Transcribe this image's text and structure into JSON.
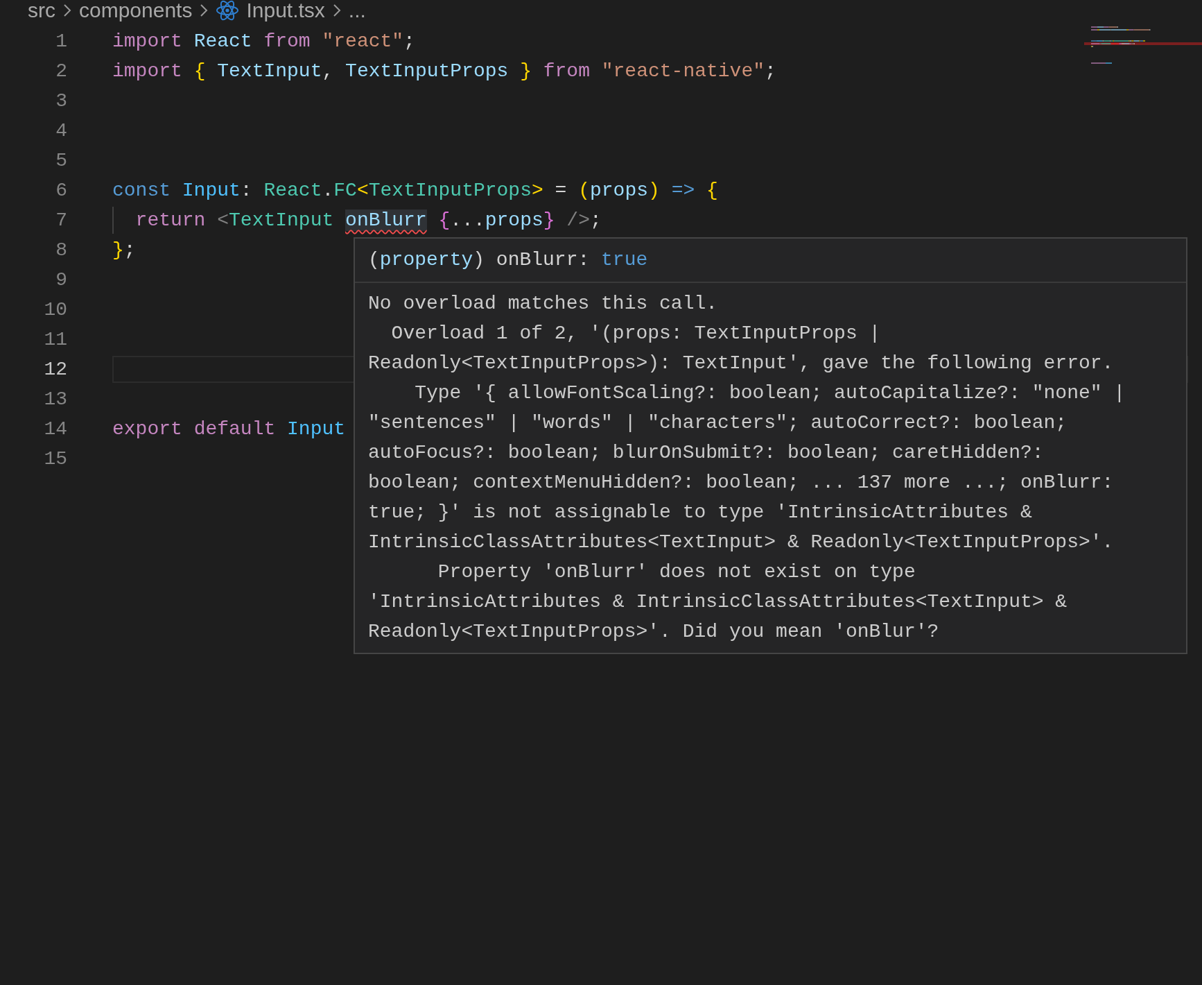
{
  "breadcrumb": [
    {
      "label": "src",
      "kind": "folder"
    },
    {
      "label": "components",
      "kind": "folder"
    },
    {
      "label": "Input.tsx",
      "kind": "react-file"
    },
    {
      "label": "...",
      "kind": "more"
    }
  ],
  "editor": {
    "lines": [
      {
        "number": "1",
        "current": false,
        "tokens": [
          {
            "text": "import",
            "kind": "keyword"
          },
          {
            "text": " React",
            "kind": "variable"
          },
          {
            "text": " from",
            "kind": "keyword"
          },
          {
            "text": " \"react\"",
            "kind": "string"
          },
          {
            "text": ";",
            "kind": "plain"
          }
        ]
      },
      {
        "number": "2",
        "current": false,
        "tokens": [
          {
            "text": "import",
            "kind": "keyword"
          },
          {
            "text": " {",
            "kind": "bracket1"
          },
          {
            "text": " TextInput",
            "kind": "variable"
          },
          {
            "text": ",",
            "kind": "plain"
          },
          {
            "text": " TextInputProps",
            "kind": "variable"
          },
          {
            "text": " }",
            "kind": "bracket1"
          },
          {
            "text": " from",
            "kind": "keyword"
          },
          {
            "text": " \"react-native\"",
            "kind": "string"
          },
          {
            "text": ";",
            "kind": "plain"
          }
        ]
      },
      {
        "number": "3",
        "current": false
      },
      {
        "number": "4",
        "current": false
      },
      {
        "number": "5",
        "current": false
      },
      {
        "number": "6",
        "current": false,
        "tokens": [
          {
            "text": "const",
            "kind": "storage"
          },
          {
            "text": " Input",
            "kind": "constant"
          },
          {
            "text": ":",
            "kind": "plain"
          },
          {
            "text": " React",
            "kind": "type"
          },
          {
            "text": ".",
            "kind": "plain"
          },
          {
            "text": "FC",
            "kind": "type"
          },
          {
            "text": "<",
            "kind": "bracket1"
          },
          {
            "text": "TextInputProps",
            "kind": "type"
          },
          {
            "text": ">",
            "kind": "bracket1"
          },
          {
            "text": " =",
            "kind": "plain"
          },
          {
            "text": " (",
            "kind": "bracket1"
          },
          {
            "text": "props",
            "kind": "variable"
          },
          {
            "text": ")",
            "kind": "bracket1"
          },
          {
            "text": " =>",
            "kind": "storage"
          },
          {
            "text": " {",
            "kind": "bracket1"
          }
        ]
      },
      {
        "number": "7",
        "current": false,
        "tokens": [
          {
            "text": "  return",
            "kind": "keyword"
          },
          {
            "text": " <",
            "kind": "tagpunct"
          },
          {
            "text": "TextInput",
            "kind": "type"
          },
          {
            "text": " onBlurr",
            "kind": "variable",
            "error": true
          },
          {
            "text": " {",
            "kind": "bracket2"
          },
          {
            "text": "...",
            "kind": "plain"
          },
          {
            "text": "props",
            "kind": "variable"
          },
          {
            "text": "}",
            "kind": "bracket2"
          },
          {
            "text": " />",
            "kind": "tagpunct"
          },
          {
            "text": ";",
            "kind": "plain"
          }
        ]
      },
      {
        "number": "8",
        "current": false,
        "tokens": [
          {
            "text": "}",
            "kind": "bracket1"
          },
          {
            "text": ";",
            "kind": "plain"
          }
        ]
      },
      {
        "number": "9",
        "current": false
      },
      {
        "number": "10",
        "current": false
      },
      {
        "number": "11",
        "current": false
      },
      {
        "number": "12",
        "current": true
      },
      {
        "number": "13",
        "current": false
      },
      {
        "number": "14",
        "current": false,
        "tokens": [
          {
            "text": "export",
            "kind": "keyword"
          },
          {
            "text": " default",
            "kind": "keyword"
          },
          {
            "text": " Input",
            "kind": "constant"
          }
        ]
      },
      {
        "number": "15",
        "current": false
      }
    ]
  },
  "hover": {
    "signature": [
      {
        "text": "(",
        "kind": "plain"
      },
      {
        "text": "property",
        "kind": "variable"
      },
      {
        "text": ") onBlurr:",
        "kind": "plain"
      },
      {
        "text": " true",
        "kind": "storage"
      }
    ],
    "message": [
      "No overload matches this call.",
      "  Overload 1 of 2, '(props: TextInputProps |",
      "Readonly<TextInputProps>): TextInput', gave the following error.",
      "    Type '{ allowFontScaling?: boolean; autoCapitalize?: \"none\" |",
      "\"sentences\" | \"words\" | \"characters\"; autoCorrect?: boolean;",
      "autoFocus?: boolean; blurOnSubmit?: boolean; caretHidden?:",
      "boolean; contextMenuHidden?: boolean; ... 137 more ...; onBlurr:",
      "true; }' is not assignable to type 'IntrinsicAttributes &",
      "IntrinsicClassAttributes<TextInput> & Readonly<TextInputProps>'.",
      "      Property 'onBlurr' does not exist on type",
      "'IntrinsicAttributes & IntrinsicClassAttributes<TextInput> &",
      "Readonly<TextInputProps>'. Did you mean 'onBlur'?"
    ]
  }
}
